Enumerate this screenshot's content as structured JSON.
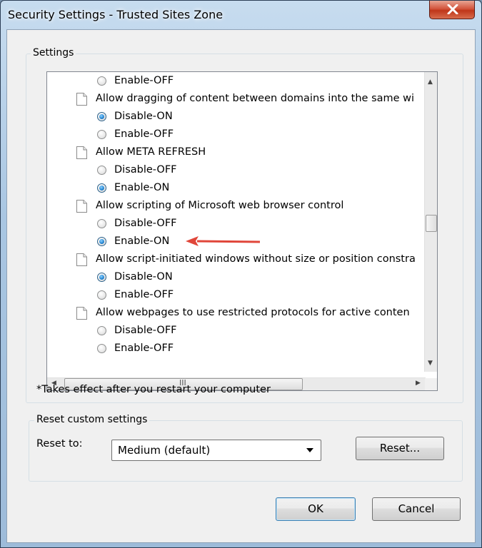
{
  "window": {
    "title": "Security Settings - Trusted Sites Zone"
  },
  "settings_group": {
    "label": "Settings"
  },
  "tree": [
    {
      "type": "radio",
      "label": "Enable-OFF",
      "checked": false
    },
    {
      "type": "header",
      "label": "Allow dragging of content between domains into the same wi"
    },
    {
      "type": "radio",
      "label": "Disable-ON",
      "checked": true
    },
    {
      "type": "radio",
      "label": "Enable-OFF",
      "checked": false
    },
    {
      "type": "header",
      "label": "Allow META REFRESH"
    },
    {
      "type": "radio",
      "label": "Disable-OFF",
      "checked": false
    },
    {
      "type": "radio",
      "label": "Enable-ON",
      "checked": true
    },
    {
      "type": "header",
      "label": "Allow scripting of Microsoft web browser control"
    },
    {
      "type": "radio",
      "label": "Disable-OFF",
      "checked": false
    },
    {
      "type": "radio",
      "label": "Enable-ON",
      "checked": true,
      "highlighted": true
    },
    {
      "type": "header",
      "label": "Allow script-initiated windows without size or position constra"
    },
    {
      "type": "radio",
      "label": "Disable-ON",
      "checked": true
    },
    {
      "type": "radio",
      "label": "Enable-OFF",
      "checked": false
    },
    {
      "type": "header",
      "label": "Allow webpages to use restricted protocols for active conten"
    },
    {
      "type": "radio",
      "label": "Disable-OFF",
      "checked": false
    },
    {
      "type": "radio",
      "label": "Enable-OFF",
      "checked": false
    }
  ],
  "hscroll_grip": "III",
  "note": "*Takes effect after you restart your computer",
  "reset_group": {
    "label": "Reset custom settings",
    "reset_to_label": "Reset to:",
    "selected": "Medium (default)",
    "reset_button": "Reset..."
  },
  "buttons": {
    "ok": "OK",
    "cancel": "Cancel"
  },
  "colors": {
    "annotation_arrow": "#e0463a",
    "radio_accent": "#2a8bd6"
  }
}
